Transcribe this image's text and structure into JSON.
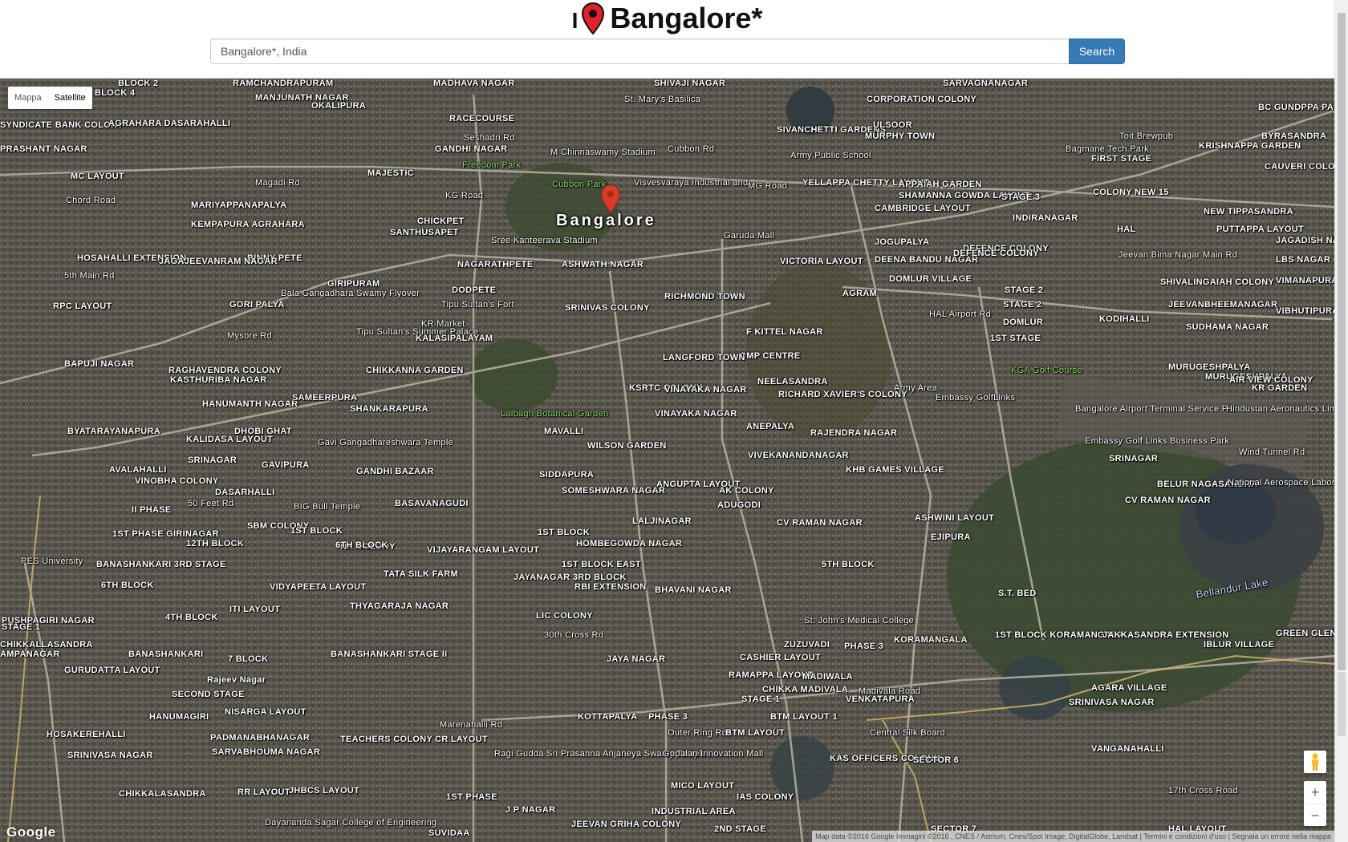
{
  "header": {
    "title_prefix": "I",
    "title": "Bangalore*",
    "pin_color": "#e0202a"
  },
  "search": {
    "value": "Bangalore*, India",
    "button_label": "Search",
    "button_color": "#337ab7"
  },
  "map": {
    "city_label": "Bangalore",
    "marker_color": "#db3a2b",
    "map_type": {
      "map_label": "Mappa",
      "satellite_label": "Satellite",
      "selected": "Satellite"
    },
    "zoom_in": "+",
    "zoom_out": "−",
    "logo": "Google",
    "attribution": "Map data ©2016 Google Immagini ©2016 , CNES / Astrium, Cnes/Spot Image, DigitalGlobe, Landsat | Termini e condizioni d'uso | Segnala un errore nella mappa",
    "labels": [
      {
        "t": "BLOCK 2",
        "k": "n"
      },
      {
        "t": "BLOCK 4",
        "k": "n"
      },
      {
        "t": "RAMCHANDRAPURAM",
        "k": "n"
      },
      {
        "t": "MADHAVA NAGAR",
        "k": "n"
      },
      {
        "t": "SHIVAJI NAGAR",
        "k": "n"
      },
      {
        "t": "SARVAGNANAGAR",
        "k": "n"
      },
      {
        "t": "CV RAMAN NAGAR",
        "k": "n"
      },
      {
        "t": "MANJUNATH NAGAR",
        "k": "n"
      },
      {
        "t": "OKALIPURA",
        "k": "n"
      },
      {
        "t": "St. Mary's Basilica",
        "k": "p"
      },
      {
        "t": "CORPORATION COLONY",
        "k": "n"
      },
      {
        "t": "BC GUNDPPA PALYA",
        "k": "n"
      },
      {
        "t": "SYNDICATE BANK COLONY",
        "k": "n"
      },
      {
        "t": "AGRAHARA DASARAHALLI",
        "k": "n"
      },
      {
        "t": "1ST BLOCK",
        "k": "n"
      },
      {
        "t": "RACECOURSE",
        "k": "n"
      },
      {
        "t": "SIVANCHETTI GARDENS",
        "k": "n"
      },
      {
        "t": "ULSOOR",
        "k": "n"
      },
      {
        "t": "MURPHY TOWN",
        "k": "n"
      },
      {
        "t": "Toit Brewpub",
        "k": "p"
      },
      {
        "t": "BYRASANDRA",
        "k": "n"
      },
      {
        "t": "PRASHANT NAGAR",
        "k": "n"
      },
      {
        "t": "6TH BLOCK",
        "k": "n"
      },
      {
        "t": "Seshadri Rd",
        "k": "r"
      },
      {
        "t": "GANDHI NAGAR",
        "k": "n"
      },
      {
        "t": "M Chinnaswamy Stadium",
        "k": "p"
      },
      {
        "t": "Cubbon Rd",
        "k": "r"
      },
      {
        "t": "Army Public School",
        "k": "p"
      },
      {
        "t": "Bagmane Tech Park",
        "k": "p"
      },
      {
        "t": "KRISHNAPPA GARDEN",
        "k": "n"
      },
      {
        "t": "FIRST STAGE",
        "k": "n"
      },
      {
        "t": "DEFENCE COLONY",
        "k": "n"
      },
      {
        "t": "CAUVERI COLONY",
        "k": "n"
      },
      {
        "t": "MC LAYOUT",
        "k": "n"
      },
      {
        "t": "Magadi Rd",
        "k": "r"
      },
      {
        "t": "MAJESTIC",
        "k": "n"
      },
      {
        "t": "Freedom Park",
        "k": "g"
      },
      {
        "t": "Cubbon Park",
        "k": "g"
      },
      {
        "t": "Visvesvaraya Industrial and...",
        "k": "p"
      },
      {
        "t": "MG Road",
        "k": "r"
      },
      {
        "t": "YELLAPPA CHETTY LAYOUT",
        "k": "n"
      },
      {
        "t": "APPAIAH GARDEN",
        "k": "n"
      },
      {
        "t": "SHAMANNA GOWDA LAYOUT",
        "k": "n"
      },
      {
        "t": "STAGE 3",
        "k": "n"
      },
      {
        "t": "COLONY NEW 15",
        "k": "n"
      },
      {
        "t": "STAGE 2",
        "k": "n"
      },
      {
        "t": "Chord Road",
        "k": "r"
      },
      {
        "t": "MARIYAPPANAPALYA",
        "k": "n"
      },
      {
        "t": "KG Road",
        "k": "r"
      },
      {
        "t": "CAMBRIDGE LAYOUT",
        "k": "n"
      },
      {
        "t": "INDIRANAGAR",
        "k": "n"
      },
      {
        "t": "NEW TIPPASANDRA",
        "k": "n"
      },
      {
        "t": "STAGE 1",
        "k": "n"
      },
      {
        "t": "KEMPAPURA AGRAHARA",
        "k": "n"
      },
      {
        "t": "CHICKPET",
        "k": "n"
      },
      {
        "t": "SANTHUSAPET",
        "k": "n"
      },
      {
        "t": "Sree Kanteerava Stadium",
        "k": "p"
      },
      {
        "t": "Garuda Mall",
        "k": "p"
      },
      {
        "t": "JOGUPALYA",
        "k": "n"
      },
      {
        "t": "HAL",
        "k": "n"
      },
      {
        "t": "PUTTAPPA LAYOUT",
        "k": "n"
      },
      {
        "t": "JAGADISH NAGAR",
        "k": "n"
      },
      {
        "t": "BINNY PETE",
        "k": "n"
      },
      {
        "t": "HOSAHALLI EXTENSION",
        "k": "n"
      },
      {
        "t": "JAGAJEEVANRAM NAGAR",
        "k": "n"
      },
      {
        "t": "NAGARATHPETE",
        "k": "n"
      },
      {
        "t": "ASHWATH NAGAR",
        "k": "n"
      },
      {
        "t": "VICTORIA LAYOUT",
        "k": "n"
      },
      {
        "t": "DEENA BANDU NAGAR",
        "k": "n"
      },
      {
        "t": "DEFENCE COLONY",
        "k": "n"
      },
      {
        "t": "Jeevan Bima Nagar Main Rd",
        "k": "r"
      },
      {
        "t": "LBS NAGAR",
        "k": "n"
      },
      {
        "t": "5th Main Rd",
        "k": "r"
      },
      {
        "t": "GIRIPURAM",
        "k": "n"
      },
      {
        "t": "DODPETE",
        "k": "n"
      },
      {
        "t": "DOMLUR VILLAGE",
        "k": "n"
      },
      {
        "t": "SHIVALINGAIAH COLONY",
        "k": "n"
      },
      {
        "t": "VIMANAPURA",
        "k": "n"
      },
      {
        "t": "RPC LAYOUT",
        "k": "n"
      },
      {
        "t": "VINAYAKA NAGAR",
        "k": "n"
      },
      {
        "t": "GORI PALYA",
        "k": "n"
      },
      {
        "t": "Bala Gangadhara Swamy Flyover",
        "k": "r"
      },
      {
        "t": "Tipu Sultan's Fort",
        "k": "p"
      },
      {
        "t": "SRINIVAS COLONY",
        "k": "n"
      },
      {
        "t": "RICHMOND TOWN",
        "k": "n"
      },
      {
        "t": "AGRAM",
        "k": "n"
      },
      {
        "t": "STAGE 2",
        "k": "n"
      },
      {
        "t": "JEEVANBHEEMANAGAR",
        "k": "n"
      },
      {
        "t": "VIBHUTIPURA",
        "k": "n"
      },
      {
        "t": "KR Market",
        "k": "p"
      },
      {
        "t": "HAL Airport Rd",
        "k": "r"
      },
      {
        "t": "DOMLUR",
        "k": "n"
      },
      {
        "t": "KODIHALLI",
        "k": "n"
      },
      {
        "t": "MURUGESHPALYA",
        "k": "n"
      },
      {
        "t": "SUDHAMA NAGAR",
        "k": "n"
      },
      {
        "t": "Tipu Sultan's Summer Palace",
        "k": "p"
      },
      {
        "t": "KALASIPALAYAM",
        "k": "n"
      },
      {
        "t": "F KITTEL NAGAR",
        "k": "n"
      },
      {
        "t": "1ST STAGE",
        "k": "n"
      },
      {
        "t": "Mysore Rd",
        "k": "r"
      },
      {
        "t": "CMP CENTRE",
        "k": "n"
      },
      {
        "t": "BAPUJI NAGAR",
        "k": "n"
      },
      {
        "t": "RAGHAVENDRA COLONY",
        "k": "n"
      },
      {
        "t": "CHIKKANNA GARDEN",
        "k": "n"
      },
      {
        "t": "LANGFORD TOWN",
        "k": "n"
      },
      {
        "t": "KGA Golf Course",
        "k": "g"
      },
      {
        "t": "MURUGESHPALYA",
        "k": "n"
      },
      {
        "t": "KASTHURIBA NAGAR",
        "k": "n"
      },
      {
        "t": "NEELASANDRA",
        "k": "n"
      },
      {
        "t": "AIR VIEW COLONY",
        "k": "n"
      },
      {
        "t": "SRINAGAR",
        "k": "n"
      },
      {
        "t": "HANUMANTH NAGAR",
        "k": "n"
      },
      {
        "t": "SAMEERPURA",
        "k": "n"
      },
      {
        "t": "KSRTC COLONY",
        "k": "n"
      },
      {
        "t": "Army Area",
        "k": "p"
      },
      {
        "t": "RICHARD XAVIER'S COLONY",
        "k": "n"
      },
      {
        "t": "Embassy GolfLinks",
        "k": "p"
      },
      {
        "t": "KR GARDEN",
        "k": "n"
      },
      {
        "t": "SHANKARAPURA",
        "k": "n"
      },
      {
        "t": "Lalbagh Botanical Garden",
        "k": "g"
      },
      {
        "t": "VINAYAKA NAGAR",
        "k": "n"
      },
      {
        "t": "Bangalore Airport Terminal Service P...",
        "k": "p"
      },
      {
        "t": "Hindustan Aeronautics Limited Airport",
        "k": "p"
      },
      {
        "t": "BYATARAYANAPURA",
        "k": "n"
      },
      {
        "t": "DHOBI GHAT",
        "k": "n"
      },
      {
        "t": "MAVALLI",
        "k": "n"
      },
      {
        "t": "ANEPALYA",
        "k": "n"
      },
      {
        "t": "RAJENDRA NAGAR",
        "k": "n"
      },
      {
        "t": "KALIDASA LAYOUT",
        "k": "n"
      },
      {
        "t": "Gavi Gangadhareshwara Temple",
        "k": "p"
      },
      {
        "t": "WILSON GARDEN",
        "k": "n"
      },
      {
        "t": "Embassy Golf Links Business Park",
        "k": "p"
      },
      {
        "t": "Wind Tunnel Rd",
        "k": "r"
      },
      {
        "t": "SRINAGAR",
        "k": "n"
      },
      {
        "t": "GAVIPURA",
        "k": "n"
      },
      {
        "t": "VIVEKANANDANAGAR",
        "k": "n"
      },
      {
        "t": "AVALAHALLI",
        "k": "n"
      },
      {
        "t": "GANDHI BAZAAR",
        "k": "n"
      },
      {
        "t": "SIDDAPURA",
        "k": "n"
      },
      {
        "t": "KHB GAMES VILLAGE",
        "k": "n"
      },
      {
        "t": "ANGUPTA LAYOUT",
        "k": "n"
      },
      {
        "t": "AK COLONY",
        "k": "n"
      },
      {
        "t": "VINOBHA COLONY",
        "k": "n"
      },
      {
        "t": "DASARHALLI",
        "k": "n"
      },
      {
        "t": "SOMESHWARA NAGAR",
        "k": "n"
      },
      {
        "t": "ADUGODI",
        "k": "n"
      },
      {
        "t": "BELUR NAGASANDRA",
        "k": "n"
      },
      {
        "t": "National Aerospace Laboratories",
        "k": "p"
      },
      {
        "t": "II PHASE",
        "k": "n"
      },
      {
        "t": "50 Feet Rd",
        "k": "r"
      },
      {
        "t": "BASAVANAGUDI",
        "k": "n"
      },
      {
        "t": "BIG Bull Temple",
        "k": "p"
      },
      {
        "t": "SBM COLONY",
        "k": "n"
      },
      {
        "t": "LALJINAGAR",
        "k": "n"
      },
      {
        "t": "CV RAMAN NAGAR",
        "k": "n"
      },
      {
        "t": "1ST BLOCK",
        "k": "n"
      },
      {
        "t": "ASHWINI LAYOUT",
        "k": "n"
      },
      {
        "t": "EJIPURA",
        "k": "n"
      },
      {
        "t": "1ST PHASE GIRINAGAR",
        "k": "n"
      },
      {
        "t": "12TH BLOCK",
        "k": "n"
      },
      {
        "t": "NR COLONY",
        "k": "n"
      },
      {
        "t": "HOMBEGOWDA NAGAR",
        "k": "n"
      },
      {
        "t": "PES University",
        "k": "p"
      },
      {
        "t": "SRINIVASA NAGAR",
        "k": "n"
      },
      {
        "t": "VIJAYARANGAM LAYOUT",
        "k": "n"
      },
      {
        "t": "1ST BLOCK EAST",
        "k": "n"
      },
      {
        "t": "5TH BLOCK",
        "k": "n"
      },
      {
        "t": "BANASHANKARI 3RD STAGE",
        "k": "n"
      },
      {
        "t": "6TH BLOCK",
        "k": "n"
      },
      {
        "t": "TATA SILK FARM",
        "k": "n"
      },
      {
        "t": "JAYANAGAR 3RD BLOCK",
        "k": "n"
      },
      {
        "t": "RBI EXTENSION",
        "k": "n"
      },
      {
        "t": "BHAVANI NAGAR",
        "k": "n"
      },
      {
        "t": "S.T. BED",
        "k": "n"
      },
      {
        "t": "Bellandur Lake",
        "k": "l"
      },
      {
        "t": "VIDYAPEETA LAYOUT",
        "k": "n"
      },
      {
        "t": "THYAGARAJA NAGAR",
        "k": "n"
      },
      {
        "t": "ITI LAYOUT",
        "k": "n"
      },
      {
        "t": "PUSHPAGIRI NAGAR",
        "k": "n"
      },
      {
        "t": "4TH BLOCK",
        "k": "n"
      },
      {
        "t": "LIC COLONY",
        "k": "n"
      },
      {
        "t": "30th Cross Rd",
        "k": "r"
      },
      {
        "t": "St. John's Medical College",
        "k": "p"
      },
      {
        "t": "ZUZUVADI",
        "k": "n"
      },
      {
        "t": "KORAMANGALA",
        "k": "n"
      },
      {
        "t": "1ST BLOCK KORAMANGALA",
        "k": "n"
      },
      {
        "t": "JAKKASANDRA EXTENSION",
        "k": "n"
      },
      {
        "t": "IBLUR VILLAGE",
        "k": "n"
      },
      {
        "t": "GREEN GLEN LAYOUT",
        "k": "n"
      },
      {
        "t": "CHIKKALLASANDRA",
        "k": "n"
      },
      {
        "t": "BANASHANKARI",
        "k": "n"
      },
      {
        "t": "AMPANAGAR",
        "k": "n"
      },
      {
        "t": "7 BLOCK",
        "k": "n"
      },
      {
        "t": "BANASHANKARI STAGE II",
        "k": "n"
      },
      {
        "t": "JAYA NAGAR",
        "k": "n"
      },
      {
        "t": "CASHIER LAYOUT",
        "k": "n"
      },
      {
        "t": "GURUDATTA LAYOUT",
        "k": "n"
      },
      {
        "t": "PHASE 3",
        "k": "n"
      },
      {
        "t": "Rajeev Nagar",
        "k": "n"
      },
      {
        "t": "RAMAPPA LAYOUT",
        "k": "n"
      },
      {
        "t": "MADIWALA",
        "k": "n"
      },
      {
        "t": "Madivala Road",
        "k": "r"
      },
      {
        "t": "AGARA VILLAGE",
        "k": "n"
      },
      {
        "t": "SECOND STAGE",
        "k": "n"
      },
      {
        "t": "STAGE 1",
        "k": "n"
      },
      {
        "t": "CHIKKA MADIVALA",
        "k": "n"
      },
      {
        "t": "VENKATAPURA",
        "k": "n"
      },
      {
        "t": "HANUMAGIRI",
        "k": "n"
      },
      {
        "t": "NISARGA LAYOUT",
        "k": "n"
      },
      {
        "t": "KOTTAPALYA",
        "k": "n"
      },
      {
        "t": "PHASE 3",
        "k": "n"
      },
      {
        "t": "BTM LAYOUT 1",
        "k": "n"
      },
      {
        "t": "Marenahalli Rd",
        "k": "r"
      },
      {
        "t": "Outer Ring Rd",
        "k": "r"
      },
      {
        "t": "BTM LAYOUT",
        "k": "n"
      },
      {
        "t": "Central Silk Board",
        "k": "p"
      },
      {
        "t": "HOSAKEREHALLI",
        "k": "n"
      },
      {
        "t": "PADMANABHANAGAR",
        "k": "n"
      },
      {
        "t": "TEACHERS COLONY",
        "k": "n"
      },
      {
        "t": "CR LAYOUT",
        "k": "n"
      },
      {
        "t": "VANGANAHALLI",
        "k": "n"
      },
      {
        "t": "SRINIVASA NAGAR",
        "k": "n"
      },
      {
        "t": "SARVABHOUMA NAGAR",
        "k": "n"
      },
      {
        "t": "Ragi Gudda Sri Prasanna Anjaneya Swamy Temple",
        "k": "p"
      },
      {
        "t": "Gopalan Innovation Mall",
        "k": "p"
      },
      {
        "t": "KAS OFFICERS COLONY",
        "k": "n"
      },
      {
        "t": "SECTOR 6",
        "k": "n"
      },
      {
        "t": "CHIKKALASANDRA",
        "k": "n"
      },
      {
        "t": "RR LAYOUT",
        "k": "n"
      },
      {
        "t": "JHBCS LAYOUT",
        "k": "n"
      },
      {
        "t": "MICO LAYOUT",
        "k": "n"
      },
      {
        "t": "IAS COLONY",
        "k": "n"
      },
      {
        "t": "17th Cross Road",
        "k": "r"
      },
      {
        "t": "1ST PHASE",
        "k": "n"
      },
      {
        "t": "J P NAGAR",
        "k": "n"
      },
      {
        "t": "INDUSTRIAL AREA",
        "k": "n"
      },
      {
        "t": "Dayananda Sagar College of Engineering",
        "k": "p"
      },
      {
        "t": "SUVIDAA",
        "k": "n"
      },
      {
        "t": "JEEVAN GRIHA COLONY",
        "k": "n"
      },
      {
        "t": "2ND STAGE",
        "k": "n"
      },
      {
        "t": "SECTOR 7",
        "k": "n"
      },
      {
        "t": "HAL LAYOUT",
        "k": "n"
      }
    ]
  }
}
